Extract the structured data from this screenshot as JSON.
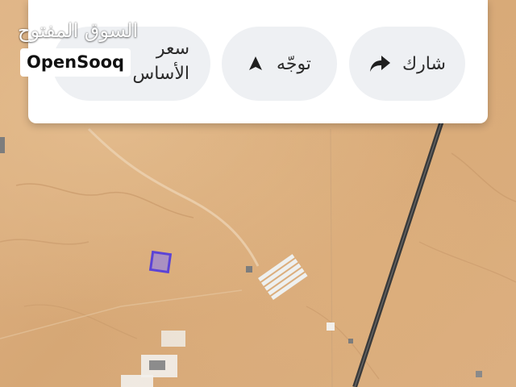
{
  "watermark": {
    "arabic": "السوق المفتوح",
    "english": "OpenSooq"
  },
  "actions": {
    "share": {
      "label": "شارك",
      "icon": "share-arrow-icon"
    },
    "navigate": {
      "label": "توجّه",
      "icon": "navigation-arrow-icon"
    },
    "price": {
      "label_line1": "سعر",
      "label_line2": "الأساس"
    }
  },
  "colors": {
    "map_sand": "#d9ae7e",
    "road": "#3a3a3a",
    "marker": "#7a63d6",
    "pill_bg": "#eef0f3"
  }
}
